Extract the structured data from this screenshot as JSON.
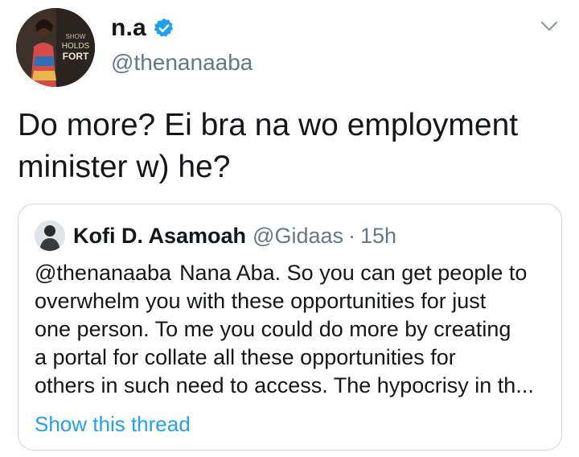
{
  "author": {
    "display_name": "n.a",
    "handle": "@thenanaaba",
    "avatar_text": [
      "SHOW",
      "HOLDS",
      "FORT"
    ]
  },
  "tweet": {
    "text_line1": "Do more? Ei bra na wo employment",
    "text_line2": "minister w) he?"
  },
  "quoted": {
    "display_name": "Kofi D. Asamoah",
    "handle": "@Gidaas",
    "separator": "·",
    "time": "15h",
    "mention": "@thenanaaba",
    "body_line1": "Nana Aba. So you can get people to",
    "body_line2": "overwhelm you with these opportunities for just",
    "body_line3": "one person. To me you could do more by creating",
    "body_line4": "a portal for collate all these opportunities for",
    "body_line5": "others in such need to access. The hypocrisy in th...",
    "show_thread": "Show this thread"
  },
  "colors": {
    "primary_text": "#14171a",
    "secondary_text": "#657786",
    "link_blue": "#1da1f2",
    "border": "#ccd6dd"
  },
  "icons": {
    "verified": "verified-badge-icon",
    "more": "chevron-down-icon"
  }
}
